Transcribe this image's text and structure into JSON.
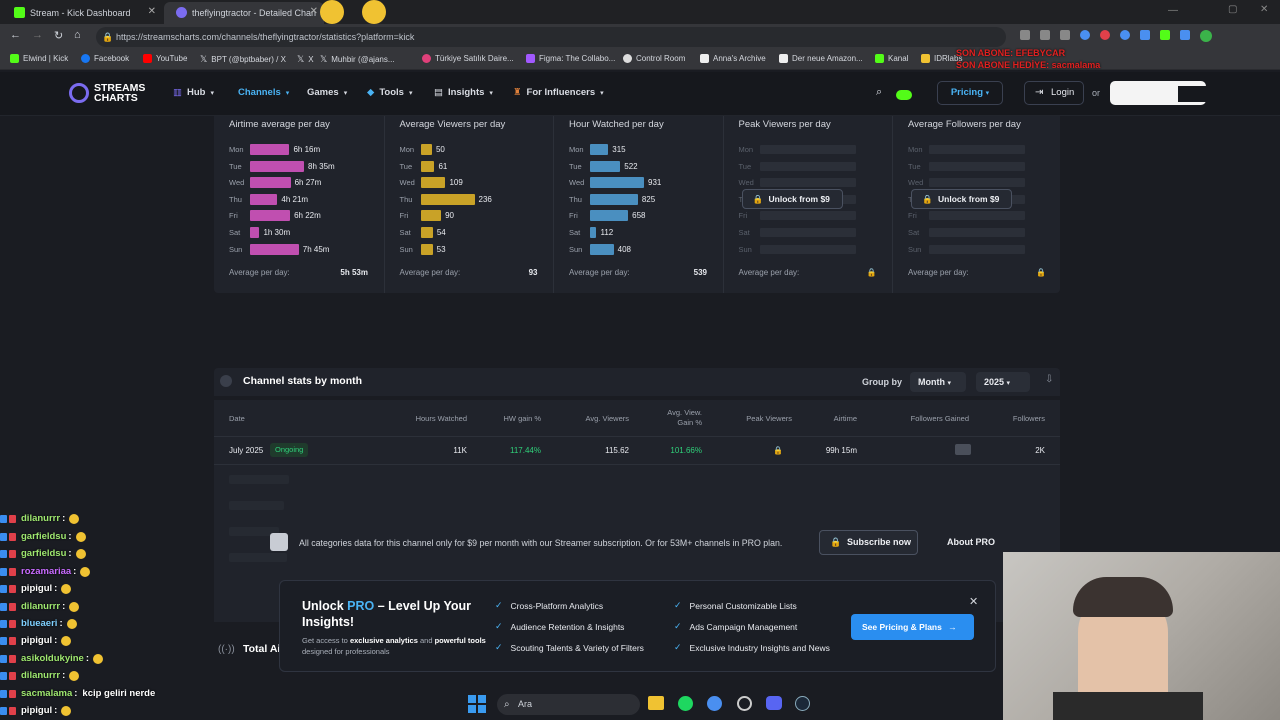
{
  "browser": {
    "tabs": [
      {
        "label": "Stream - Kick Dashboard",
        "active": false,
        "favicon_color": "#53fc18"
      },
      {
        "label": "theflyingtractor - Detailed Chan",
        "active": true,
        "favicon_color": "#7b6cf0"
      }
    ],
    "url": "https://streamscharts.com/channels/theflyingtractor/statistics?platform=kick",
    "bookmarks": [
      {
        "label": "Elwind | Kick",
        "color": "#53fc18"
      },
      {
        "label": "Facebook",
        "color": "#1877f2"
      },
      {
        "label": "YouTube",
        "color": "#ff0000"
      },
      {
        "label": "BPT (@bptbaber) / X",
        "color": "#ffffff"
      },
      {
        "label": "X",
        "color": "#ffffff"
      },
      {
        "label": "Muhbir (@ajans...",
        "color": "#ffffff"
      },
      {
        "label": "Türkiye Satılık Daire...",
        "color": "#e0407a"
      },
      {
        "label": "Figma: The Collabo...",
        "color": "#a259ff"
      },
      {
        "label": "Control Room",
        "color": "#dddddd"
      },
      {
        "label": "Anna's Archive",
        "color": "#eeeeee"
      },
      {
        "label": "Der neue Amazon...",
        "color": "#eeeeee"
      },
      {
        "label": "Kanal",
        "color": "#53fc18"
      },
      {
        "label": "IDRlabs",
        "color": "#f0c232"
      }
    ]
  },
  "site": {
    "logo": "STREAMS CHARTS",
    "nav": [
      {
        "label": "Hub"
      },
      {
        "label": "Channels",
        "active": true
      },
      {
        "label": "Games"
      },
      {
        "label": "Tools"
      },
      {
        "label": "Insights"
      },
      {
        "label": "For Influencers"
      }
    ],
    "pricing_label": "Pricing",
    "login_label": "Login",
    "or_label": "or"
  },
  "weekly": {
    "days": [
      "Mon",
      "Tue",
      "Wed",
      "Thu",
      "Fri",
      "Sat",
      "Sun"
    ],
    "avg_label": "Average per day:",
    "columns": [
      {
        "title": "Airtime average per day",
        "color": "#c04fb0",
        "values": [
          6.27,
          8.58,
          6.45,
          4.35,
          6.37,
          1.5,
          7.75
        ],
        "labels": [
          "6h 16m",
          "8h 35m",
          "6h 27m",
          "4h 21m",
          "6h 22m",
          "1h 30m",
          "7h 45m"
        ],
        "max": 8.58,
        "avg": "5h 53m"
      },
      {
        "title": "Average Viewers per day",
        "color": "#c9a227",
        "values": [
          50,
          61,
          109,
          236,
          90,
          54,
          53
        ],
        "labels": [
          "50",
          "61",
          "109",
          "236",
          "90",
          "54",
          "53"
        ],
        "max": 236,
        "avg": "93"
      },
      {
        "title": "Hour Watched per day",
        "color": "#4a8fc0",
        "values": [
          315,
          522,
          931,
          825,
          658,
          112,
          408
        ],
        "labels": [
          "315",
          "522",
          "931",
          "825",
          "658",
          "112",
          "408"
        ],
        "max": 931,
        "avg": "539"
      },
      {
        "title": "Peak Viewers per day",
        "locked": true,
        "unlock_label": "Unlock from $9"
      },
      {
        "title": "Average Followers per day",
        "locked": true,
        "unlock_label": "Unlock from $9"
      }
    ]
  },
  "stats_by_month": {
    "title": "Channel stats by month",
    "group_by_label": "Group by",
    "group_value": "Month",
    "year_value": "2025",
    "headers": [
      "Date",
      "Hours Watched",
      "HW gain %",
      "Avg. Viewers",
      "Avg. View. Gain %",
      "Peak Viewers",
      "Airtime",
      "Followers Gained",
      "Followers"
    ],
    "row": {
      "date": "July 2025",
      "badge": "Ongoing",
      "hours_watched": "11K",
      "hw_gain": "117.44%",
      "avg_viewers": "115.62",
      "avg_view_gain": "101.66%",
      "airtime": "99h 15m",
      "followers": "2K"
    },
    "lock_message": "All categories data for this channel only for $9 per month with our Streamer subscription. Or for 53M+ channels in PRO plan.",
    "subscribe_label": "Subscribe now",
    "about_label": "About PRO",
    "accent_green": "#2fd07a"
  },
  "promo": {
    "title_prefix": "Unlock ",
    "title_pro": "PRO",
    "title_suffix": " – Level Up Your Insights!",
    "sub_a": "Get access to ",
    "sub_b": "exclusive analytics",
    "sub_c": " and ",
    "sub_d": "powerful tools",
    "sub_e": " designed for professionals",
    "features": [
      "Cross-Platform Analytics",
      "Audience Retention & Insights",
      "Scouting Talents & Variety of Filters",
      "Personal Customizable Lists",
      "Ads Campaign Management",
      "Exclusive Industry Insights and News"
    ],
    "cta": "See Pricing & Plans"
  },
  "section_partial": "Total Ai",
  "chat": [
    {
      "user": "dilanurrr",
      "color": "#9fe870",
      "msg": ""
    },
    {
      "user": "garfieldsu",
      "color": "#9fe870",
      "msg": ""
    },
    {
      "user": "garfieldsu",
      "color": "#9fe870",
      "msg": ""
    },
    {
      "user": "rozamariaa",
      "color": "#c86bff",
      "msg": ""
    },
    {
      "user": "pipigul",
      "color": "#ffffff",
      "msg": ""
    },
    {
      "user": "dilanurrr",
      "color": "#9fe870",
      "msg": ""
    },
    {
      "user": "blueaeri",
      "color": "#7fd0ff",
      "msg": ""
    },
    {
      "user": "pipigul",
      "color": "#ffffff",
      "msg": ""
    },
    {
      "user": "asikoldukyine",
      "color": "#9fe870",
      "msg": ""
    },
    {
      "user": "dilanurrr",
      "color": "#9fe870",
      "msg": ""
    },
    {
      "user": "sacmalama",
      "color": "#9fe870",
      "msg": "kcip geliri nerde"
    },
    {
      "user": "pipigul",
      "color": "#ffffff",
      "msg": ""
    }
  ],
  "overlay_alerts": [
    "SON ABONE: EFEBYCAR",
    "SON ABONE HEDİYE: sacmalama"
  ],
  "taskbar": {
    "search_label": "Ara"
  }
}
